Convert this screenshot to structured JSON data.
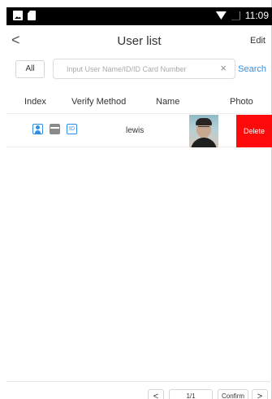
{
  "statusbar": {
    "time": "11:09",
    "icons": [
      "picture-icon",
      "sd-card-icon",
      "wifi-icon",
      "no-signal-icon"
    ]
  },
  "header": {
    "title": "User list",
    "edit_label": "Edit",
    "back_glyph": "<"
  },
  "search": {
    "all_label": "All",
    "placeholder": "Input User Name/ID/ID Card Number",
    "search_label": "Search",
    "clear_glyph": "×"
  },
  "table": {
    "columns": [
      "Index",
      "Verify Method",
      "Name",
      "Photo"
    ],
    "rows": [
      {
        "verify_methods": [
          "face-icon",
          "card-icon",
          "id-icon"
        ],
        "id_icon_text": "ID",
        "name": "lewis",
        "delete_label": "Delete"
      }
    ]
  },
  "pager": {
    "prev": "<",
    "page": "1/1",
    "confirm": "Confirm",
    "next": ">"
  },
  "colors": {
    "accent": "#2f8fe8",
    "delete": "#ff0a0a",
    "statusbar": "#000000"
  }
}
